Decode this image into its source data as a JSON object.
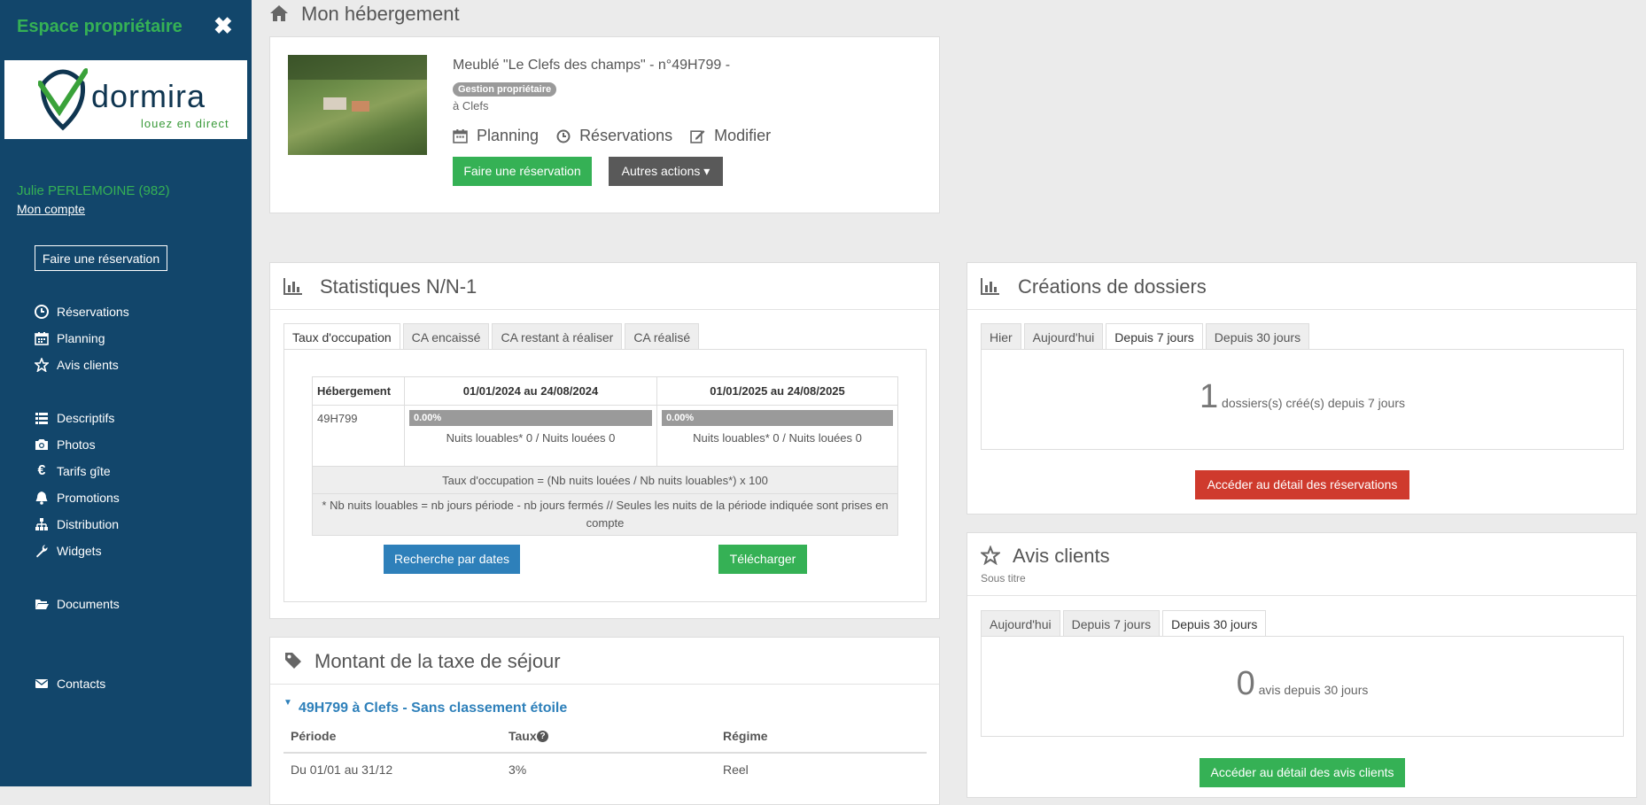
{
  "sidebar": {
    "title": "Espace propriétaire",
    "logo_text": "dormira",
    "logo_sub": "louez en direct",
    "user": "Julie PERLEMOINE (982)",
    "account_link": "Mon compte",
    "reserve_button": "Faire une réservation",
    "items": [
      {
        "label": "Réservations",
        "icon": "clock-icon"
      },
      {
        "label": "Planning",
        "icon": "calendar-icon"
      },
      {
        "label": "Avis clients",
        "icon": "star-icon"
      },
      {
        "label": "Descriptifs",
        "icon": "list-icon"
      },
      {
        "label": "Photos",
        "icon": "camera-icon"
      },
      {
        "label": "Tarifs gîte",
        "icon": "euro-icon"
      },
      {
        "label": "Promotions",
        "icon": "bell-icon"
      },
      {
        "label": "Distribution",
        "icon": "sitemap-icon"
      },
      {
        "label": "Widgets",
        "icon": "wrench-icon"
      },
      {
        "label": "Documents",
        "icon": "folder-icon"
      },
      {
        "label": "Contacts",
        "icon": "envelope-icon"
      }
    ]
  },
  "header": {
    "title": "Mon hébergement"
  },
  "property": {
    "name": "Meublé \"Le Clefs des champs\" - n°49H799 -",
    "badge": "Gestion propriétaire",
    "location": "à Clefs",
    "links": {
      "planning": "Planning",
      "reservations": "Réservations",
      "modify": "Modifier"
    },
    "reserve_button": "Faire une réservation",
    "actions_button": "Autres actions ▾"
  },
  "stats": {
    "title": "Statistiques N/N-1",
    "tabs": [
      "Taux d'occupation",
      "CA encaissé",
      "CA restant à réaliser",
      "CA réalisé"
    ],
    "col_header": "Hébergement",
    "period1": "01/01/2024 au 24/08/2024",
    "period2": "01/01/2025 au 24/08/2025",
    "row_label": "49H799",
    "rate1": "0.00%",
    "rate1_value": 0,
    "rate2": "0.00%",
    "rate2_value": 0,
    "nights1": "Nuits louables* 0 / Nuits louées 0",
    "nights2": "Nuits louables* 0 / Nuits louées 0",
    "formula": "Taux d'occupation = (Nb nuits louées / Nb nuits louables*) x 100",
    "note": "* Nb nuits louables = nb jours période - nb jours fermés // Seules les nuits de la période indiquée sont prises en compte",
    "search_button": "Recherche par dates",
    "download_button": "Télécharger"
  },
  "tax": {
    "title": "Montant de la taxe de séjour",
    "subtitle": "49H799 à Clefs - Sans classement étoile",
    "col_period": "Période",
    "col_rate": "Taux",
    "col_regime": "Régime",
    "row": {
      "period": "Du 01/01 au 31/12",
      "rate": "3%",
      "regime": "Reel"
    }
  },
  "dossiers": {
    "title": "Créations de dossiers",
    "tabs": [
      "Hier",
      "Aujourd'hui",
      "Depuis 7 jours",
      "Depuis 30 jours"
    ],
    "count": "1",
    "count_label": "dossiers(s) créé(s) depuis 7 jours",
    "button": "Accéder au détail des réservations"
  },
  "reviews": {
    "title": "Avis clients",
    "subtitle": "Sous titre",
    "tabs": [
      "Aujourd'hui",
      "Depuis 7 jours",
      "Depuis 30 jours"
    ],
    "count": "0",
    "count_label": "avis depuis 30 jours",
    "button": "Accéder au détail des avis clients"
  }
}
